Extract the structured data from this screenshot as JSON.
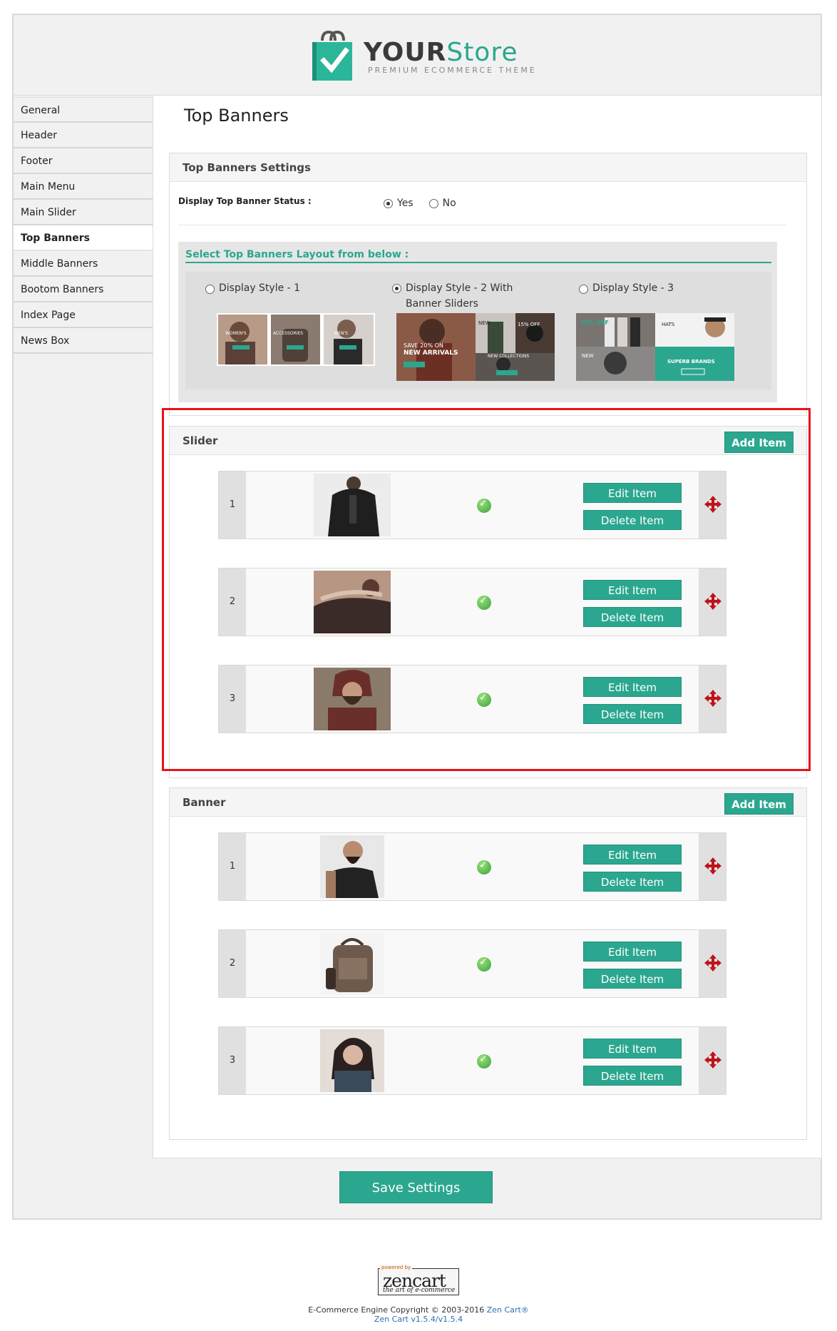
{
  "brand": {
    "name_part1": "YOUR",
    "name_part2": "Store",
    "tagline": "PREMIUM ECOMMERCE THEME"
  },
  "sidebar": {
    "items": [
      {
        "label": "General"
      },
      {
        "label": "Header"
      },
      {
        "label": "Footer"
      },
      {
        "label": "Main Menu"
      },
      {
        "label": "Main Slider"
      },
      {
        "label": "Top Banners",
        "active": true
      },
      {
        "label": "Middle Banners"
      },
      {
        "label": "Bootom Banners"
      },
      {
        "label": "Index Page"
      },
      {
        "label": "News Box"
      }
    ]
  },
  "page": {
    "title": "Top Banners"
  },
  "settings": {
    "title": "Top Banners Settings",
    "status_label": "Display Top Banner Status :",
    "status_options": [
      {
        "label": "Yes",
        "checked": true
      },
      {
        "label": "No",
        "checked": false
      }
    ],
    "layout_title": "Select Top Banners Layout from below :",
    "layout_options": [
      {
        "label": "Display Style - 1",
        "checked": false
      },
      {
        "label": "Display Style - 2 With Banner Sliders",
        "checked": true
      },
      {
        "label": "Display Style - 3",
        "checked": false
      }
    ],
    "style1_labels": [
      "WOMEN'S",
      "ACCESSORIES",
      "MEN'S"
    ],
    "style2_labels": [
      "SAVE 20% ON",
      "NEW ARRIVALS",
      "NEW",
      "15% OFF",
      "NEW COLLECTIONS"
    ],
    "style3_labels": [
      "15% OFF",
      "HATS",
      "NEW",
      "SUPERB BRANDS"
    ]
  },
  "slider": {
    "title": "Slider",
    "add_label": "Add Item",
    "rows": [
      {
        "num": "1",
        "edit": "Edit Item",
        "delete": "Delete Item"
      },
      {
        "num": "2",
        "edit": "Edit Item",
        "delete": "Delete Item"
      },
      {
        "num": "3",
        "edit": "Edit Item",
        "delete": "Delete Item"
      }
    ]
  },
  "banner": {
    "title": "Banner",
    "add_label": "Add Item",
    "rows": [
      {
        "num": "1",
        "edit": "Edit Item",
        "delete": "Delete Item"
      },
      {
        "num": "2",
        "edit": "Edit Item",
        "delete": "Delete Item"
      },
      {
        "num": "3",
        "edit": "Edit Item",
        "delete": "Delete Item"
      }
    ]
  },
  "save_label": "Save Settings",
  "footer": {
    "zc_powered": "powered by",
    "zc_name": "zencart",
    "zc_tag": "the art of e-commerce",
    "copyright": "E-Commerce Engine Copyright © 2003-2016",
    "copyright_link": "Zen Cart®",
    "version": "Zen Cart v1.5.4/v1.5.4"
  },
  "colors": {
    "accent": "#2ba78f",
    "highlight": "#e8121a",
    "move_icon": "#c0121a"
  }
}
